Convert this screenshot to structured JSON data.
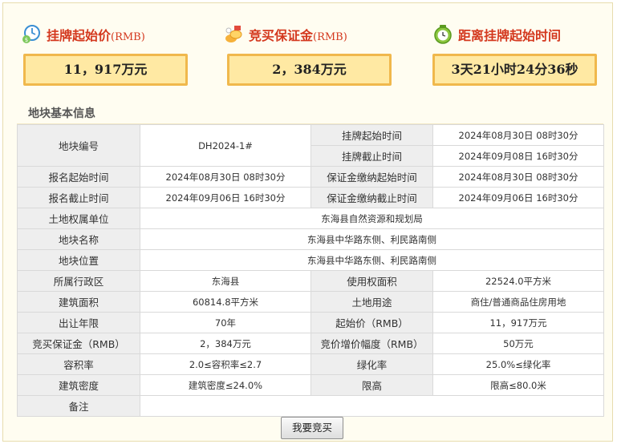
{
  "summary": {
    "start_price": {
      "title": "挂牌起始价",
      "unit": "(RMB)",
      "value": "11，917万元"
    },
    "deposit": {
      "title": "竞买保证金",
      "unit": "(RMB)",
      "value": "2，384万元"
    },
    "countdown": {
      "title": "距离挂牌起始时间",
      "value": "3天21小时24分36秒"
    },
    "icons": [
      "money-icon",
      "coins-icon",
      "clock-icon"
    ]
  },
  "section": {
    "title": "地块基本信息"
  },
  "table": {
    "parcel_no_label": "地块编号",
    "parcel_no": "DH2024-1#",
    "listing_start_label": "挂牌起始时间",
    "listing_start": "2024年08月30日 08时30分",
    "listing_end_label": "挂牌截止时间",
    "listing_end": "2024年09月08日 16时30分",
    "reg_start_label": "报名起始时间",
    "reg_start": "2024年08月30日 08时30分",
    "deposit_start_label": "保证金缴纳起始时间",
    "deposit_start": "2024年08月30日 08时30分",
    "reg_end_label": "报名截止时间",
    "reg_end": "2024年09月06日 16时30分",
    "deposit_end_label": "保证金缴纳截止时间",
    "deposit_end": "2024年09月06日 16时30分",
    "owner_label": "土地权属单位",
    "owner": "东海县自然资源和规划局",
    "name_label": "地块名称",
    "name": "东海县中华路东侧、利民路南侧",
    "location_label": "地块位置",
    "location": "东海县中华路东侧、利民路南侧",
    "district_label": "所属行政区",
    "district": "东海县",
    "use_area_label": "使用权面积",
    "use_area": "22524.0平方米",
    "build_area_label": "建筑面积",
    "build_area": "60814.8平方米",
    "land_use_label": "土地用途",
    "land_use": "商住/普通商品住房用地",
    "term_label": "出让年限",
    "term": "70年",
    "start_price_label": "起始价（RMB）",
    "start_price": "11，917万元",
    "deposit_label": "竞买保证金（RMB）",
    "deposit": "2，384万元",
    "increment_label": "竞价增价幅度（RMB）",
    "increment": "50万元",
    "far_label": "容积率",
    "far": "2.0≤容积率≤2.7",
    "green_label": "绿化率",
    "green": "25.0%≤绿化率",
    "density_label": "建筑密度",
    "density": "建筑密度≤24.0%",
    "height_label": "限高",
    "height": "限高≤80.0米",
    "remark_label": "备注",
    "remark": ""
  },
  "button": {
    "bid_label": "我要竞买"
  }
}
